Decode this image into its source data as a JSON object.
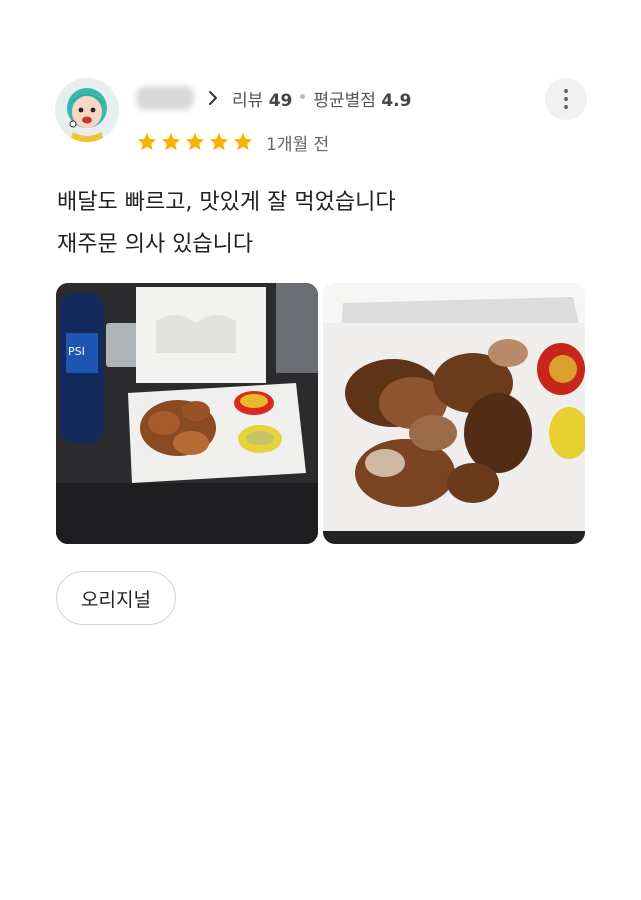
{
  "review": {
    "reviewer": {
      "avatar_icon": "avatar-icon",
      "review_label": "리뷰",
      "review_count": "49",
      "avg_rating_label": "평균별점",
      "avg_rating": "4.9"
    },
    "rating": {
      "stars": 5,
      "max": 5,
      "star_color": "#f5b301"
    },
    "time_ago": "1개월 전",
    "text_lines": [
      "배달도 빠르고, 맛있게 잘 먹었습니다",
      "재주문 의사 있습니다"
    ],
    "photos": [
      {
        "icon": "food-photo-chicken-box-with-drink"
      },
      {
        "icon": "food-photo-chicken-closeup"
      }
    ],
    "menu_chip": "오리지널",
    "more_icon": "more-vertical-icon"
  }
}
